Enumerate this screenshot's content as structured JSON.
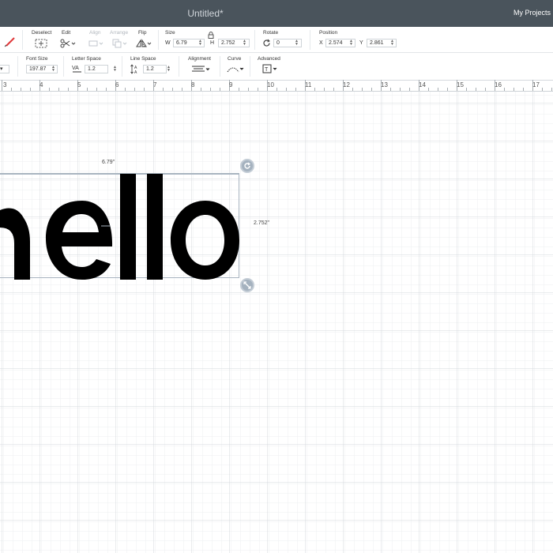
{
  "app": {
    "title": "Untitled*",
    "my_projects": "My Projects"
  },
  "toolbar1": {
    "deselect": "Deselect",
    "edit": "Edit",
    "align": "Align",
    "arrange": "Arrange",
    "flip": "Flip",
    "size": "Size",
    "w_label": "W",
    "w_value": "6.79",
    "h_label": "H",
    "h_value": "2.752",
    "rotate": "Rotate",
    "rotate_value": "0",
    "position": "Position",
    "x_label": "X",
    "x_value": "2.574",
    "y_label": "Y",
    "y_value": "2.861"
  },
  "toolbar2": {
    "font_size": "Font Size",
    "font_size_value": "197.87",
    "letter_space": "Letter Space",
    "letter_space_value": "1.2",
    "line_space": "Line Space",
    "line_space_value": "1.2",
    "alignment": "Alignment",
    "curve": "Curve",
    "advanced": "Advanced"
  },
  "ruler": [
    "3",
    "4",
    "5",
    "6",
    "7",
    "8",
    "9",
    "10",
    "11",
    "12",
    "13",
    "14",
    "15",
    "16",
    "17"
  ],
  "canvas": {
    "text": "hello",
    "width_label": "6.79\"",
    "height_label": "2.752\""
  },
  "colors": {
    "titlebar": "#4a545c",
    "grid_minor": "#eef0f2",
    "grid_major": "#d3d8dc",
    "selection": "#a8b4c0",
    "pen_red": "#e0383a"
  }
}
